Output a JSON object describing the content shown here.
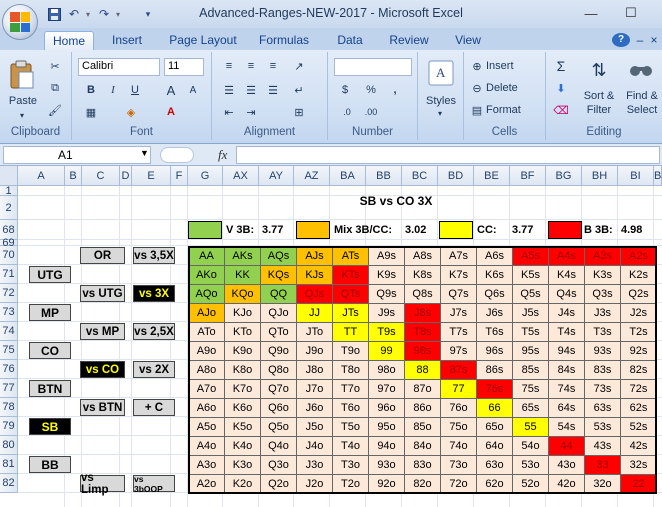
{
  "window": {
    "title": "Advanced-Ranges-NEW-2017 - Microsoft Excel",
    "minimize": "—",
    "restore": "☐"
  },
  "qat_icons": [
    "save-icon",
    "undo-icon",
    "redo-icon",
    "customize-qat-icon"
  ],
  "tabs": [
    "Home",
    "Insert",
    "Page Layout",
    "Formulas",
    "Data",
    "Review",
    "View"
  ],
  "ribbon": {
    "clipboard": {
      "label": "Clipboard",
      "paste": "Paste"
    },
    "font": {
      "label": "Font",
      "name": "Calibri",
      "size": "11",
      "bold": "B",
      "italic": "I",
      "underline": "U",
      "grow": "A",
      "shrink": "A"
    },
    "alignment": {
      "label": "Alignment"
    },
    "number": {
      "label": "Number",
      "format": "",
      "percent": "%",
      "comma": ","
    },
    "styles": {
      "label": "Styles"
    },
    "cells": {
      "label": "Cells",
      "insert": "Insert",
      "delete": "Delete",
      "format": "Format"
    },
    "editing": {
      "label": "Editing",
      "sort": "Sort &",
      "filter": "Filter",
      "find": "Find &",
      "select": "Select"
    }
  },
  "formula_bar": {
    "name_box": "A1",
    "fx": "fx",
    "content": ""
  },
  "columns": [
    "A",
    "B",
    "C",
    "D",
    "E",
    "F",
    "G",
    "AX",
    "AY",
    "AZ",
    "BA",
    "BB",
    "BC",
    "BD",
    "BE",
    "BF",
    "BG",
    "BH",
    "BI",
    "BJ"
  ],
  "rows": [
    "1",
    "2",
    "68",
    "69",
    "70",
    "71",
    "72",
    "73",
    "74",
    "75",
    "76",
    "77",
    "78",
    "79",
    "80",
    "81",
    "82"
  ],
  "sheet_title": "SB vs CO 3X",
  "legend": [
    {
      "label": "V 3B:",
      "value": "3.77",
      "color": "#92d050"
    },
    {
      "label": "Mix 3B/CC:",
      "value": "3.02",
      "color": "#ffc000"
    },
    {
      "label": "CC:",
      "value": "3.77",
      "color": "#ffff00"
    },
    {
      "label": "B 3B:",
      "value": "4.98",
      "color": "#ff0000"
    }
  ],
  "positions": [
    "UTG",
    "MP",
    "CO",
    "BTN",
    "SB",
    "BB"
  ],
  "highlight_position": "SB",
  "actions_left": [
    "OR",
    "vs UTG",
    "vs MP",
    "vs CO",
    "vs BTN",
    "vs Limp"
  ],
  "actions_right": [
    "vs 3,5X",
    "vs 3X",
    "vs 2,5X",
    "vs 2X",
    "+ C",
    "vs 3bOOP"
  ],
  "highlight_action_left": "vs CO",
  "highlight_action_right": "vs 3X",
  "hand_grid": [
    [
      "AA",
      "AKs",
      "AQs",
      "AJs",
      "ATs",
      "A9s",
      "A8s",
      "A7s",
      "A6s",
      "A5s",
      "A4s",
      "A3s",
      "A2s"
    ],
    [
      "AKo",
      "KK",
      "KQs",
      "KJs",
      "KTs",
      "K9s",
      "K8s",
      "K7s",
      "K6s",
      "K5s",
      "K4s",
      "K3s",
      "K2s"
    ],
    [
      "AQo",
      "KQo",
      "QQ",
      "QJs",
      "QTs",
      "Q9s",
      "Q8s",
      "Q7s",
      "Q6s",
      "Q5s",
      "Q4s",
      "Q3s",
      "Q2s"
    ],
    [
      "AJo",
      "KJo",
      "QJo",
      "JJ",
      "JTs",
      "J9s",
      "J8s",
      "J7s",
      "J6s",
      "J5s",
      "J4s",
      "J3s",
      "J2s"
    ],
    [
      "ATo",
      "KTo",
      "QTo",
      "JTo",
      "TT",
      "T9s",
      "T8s",
      "T7s",
      "T6s",
      "T5s",
      "T4s",
      "T3s",
      "T2s"
    ],
    [
      "A9o",
      "K9o",
      "Q9o",
      "J9o",
      "T9o",
      "99",
      "98s",
      "97s",
      "96s",
      "95s",
      "94s",
      "93s",
      "92s"
    ],
    [
      "A8o",
      "K8o",
      "Q8o",
      "J8o",
      "T8o",
      "98o",
      "88",
      "87s",
      "86s",
      "85s",
      "84s",
      "83s",
      "82s"
    ],
    [
      "A7o",
      "K7o",
      "Q7o",
      "J7o",
      "T7o",
      "97o",
      "87o",
      "77",
      "76s",
      "75s",
      "74s",
      "73s",
      "72s"
    ],
    [
      "A6o",
      "K6o",
      "Q6o",
      "J6o",
      "T6o",
      "96o",
      "86o",
      "76o",
      "66",
      "65s",
      "64s",
      "63s",
      "62s"
    ],
    [
      "A5o",
      "K5o",
      "Q5o",
      "J5o",
      "T5o",
      "95o",
      "85o",
      "75o",
      "65o",
      "55",
      "54s",
      "53s",
      "52s"
    ],
    [
      "A4o",
      "K4o",
      "Q4o",
      "J4o",
      "T4o",
      "94o",
      "84o",
      "74o",
      "64o",
      "54o",
      "44",
      "43s",
      "42s"
    ],
    [
      "A3o",
      "K3o",
      "Q3o",
      "J3o",
      "T3o",
      "93o",
      "83o",
      "73o",
      "63o",
      "53o",
      "43o",
      "33",
      "32s"
    ],
    [
      "A2o",
      "K2o",
      "Q2o",
      "J2o",
      "T2o",
      "92o",
      "82o",
      "72o",
      "62o",
      "52o",
      "42o",
      "32o",
      "22"
    ]
  ],
  "hand_colors": [
    [
      "G",
      "G",
      "G",
      "O",
      "O",
      "N",
      "N",
      "N",
      "N",
      "R",
      "R",
      "R",
      "R"
    ],
    [
      "G",
      "G",
      "O",
      "O",
      "R",
      "N",
      "N",
      "N",
      "N",
      "N",
      "N",
      "N",
      "N"
    ],
    [
      "G",
      "O",
      "G",
      "R",
      "R",
      "N",
      "N",
      "N",
      "N",
      "N",
      "N",
      "N",
      "N"
    ],
    [
      "O",
      "N",
      "N",
      "Y",
      "Y",
      "N",
      "R",
      "N",
      "N",
      "N",
      "N",
      "N",
      "N"
    ],
    [
      "N",
      "N",
      "N",
      "N",
      "Y",
      "Y",
      "R",
      "N",
      "N",
      "N",
      "N",
      "N",
      "N"
    ],
    [
      "N",
      "N",
      "N",
      "N",
      "N",
      "Y",
      "R",
      "N",
      "N",
      "N",
      "N",
      "N",
      "N"
    ],
    [
      "N",
      "N",
      "N",
      "N",
      "N",
      "N",
      "Y",
      "R",
      "N",
      "N",
      "N",
      "N",
      "N"
    ],
    [
      "N",
      "N",
      "N",
      "N",
      "N",
      "N",
      "N",
      "Y",
      "R",
      "N",
      "N",
      "N",
      "N"
    ],
    [
      "N",
      "N",
      "N",
      "N",
      "N",
      "N",
      "N",
      "N",
      "Y",
      "N",
      "N",
      "N",
      "N"
    ],
    [
      "N",
      "N",
      "N",
      "N",
      "N",
      "N",
      "N",
      "N",
      "N",
      "Y",
      "N",
      "N",
      "N"
    ],
    [
      "N",
      "N",
      "N",
      "N",
      "N",
      "N",
      "N",
      "N",
      "N",
      "N",
      "R",
      "N",
      "N"
    ],
    [
      "N",
      "N",
      "N",
      "N",
      "N",
      "N",
      "N",
      "N",
      "N",
      "N",
      "N",
      "R",
      "N"
    ],
    [
      "N",
      "N",
      "N",
      "N",
      "N",
      "N",
      "N",
      "N",
      "N",
      "N",
      "N",
      "N",
      "R"
    ]
  ],
  "palette": {
    "G": "#92d050",
    "O": "#ffc000",
    "Y": "#ffff00",
    "R": "#ff0000",
    "N": "#fde9d9",
    "N_text": "#000000",
    "R_text": "#a00000"
  }
}
